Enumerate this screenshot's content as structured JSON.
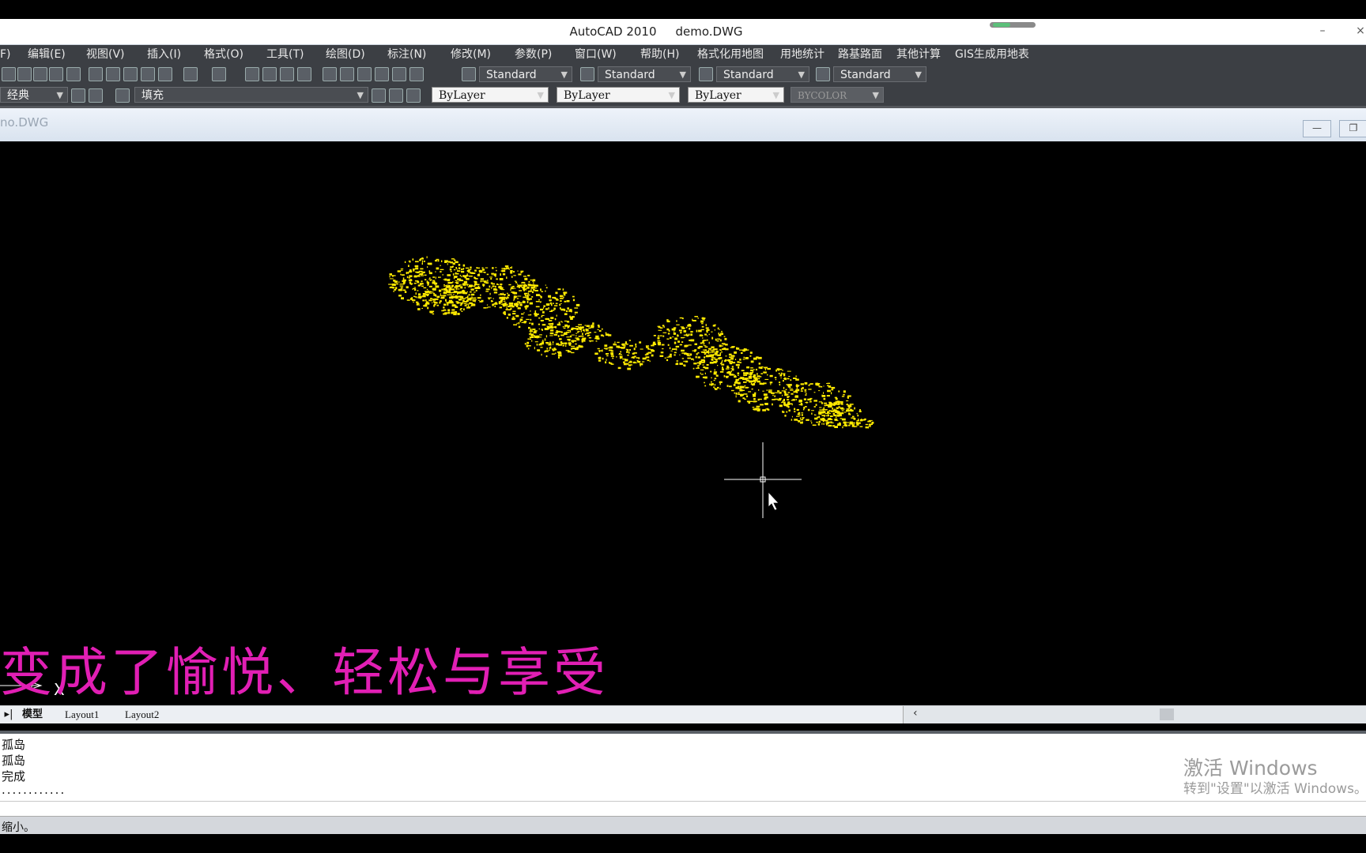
{
  "window": {
    "app_title": "AutoCAD 2010",
    "file_title": "demo.DWG",
    "minimize": "–",
    "close": "×"
  },
  "menu": [
    "F)",
    "编辑(E)",
    "视图(V)",
    "插入(I)",
    "格式(O)",
    "工具(T)",
    "绘图(D)",
    "标注(N)",
    "修改(M)",
    "参数(P)",
    "窗口(W)",
    "帮助(H)",
    "格式化用地图",
    "用地统计",
    "路基路面",
    "其他计算",
    "GIS生成用地表"
  ],
  "toolbar_styles": {
    "text_style": "Standard",
    "dim_style": "Standard",
    "table_style": "Standard",
    "multileader_style": "Standard"
  },
  "toolbar_props": {
    "workspace": "经典",
    "layer": "填充",
    "color": "ByLayer",
    "linetype": "ByLayer",
    "lineweight": "ByLayer",
    "plotstyle": "BYCOLOR"
  },
  "doc": {
    "title": "no.DWG"
  },
  "subtitle": "变成了愉悦、轻松与享受",
  "tabs": {
    "model": "模型",
    "layout1": "Layout1",
    "layout2": "Layout2"
  },
  "command_history": [
    "孤岛",
    "孤岛",
    "完成",
    "............"
  ],
  "activation": {
    "line1": "激活 Windows",
    "line2": "转到\"设置\"以激活 Windows。"
  },
  "status": {
    "prompt": "缩小。"
  },
  "colors": {
    "drawing": "#ffea00",
    "subtitle": "#e11fb4",
    "canvas": "#000000"
  }
}
